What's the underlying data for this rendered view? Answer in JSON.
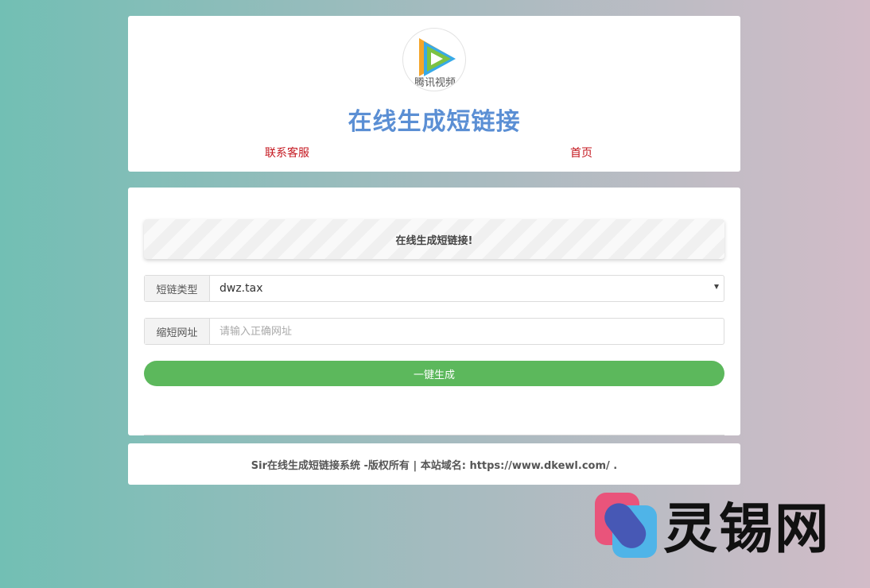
{
  "header": {
    "logo_text": "腾讯视频",
    "title": "在线生成短链接",
    "nav": [
      {
        "label": "联系客服"
      },
      {
        "label": "首页"
      }
    ]
  },
  "form": {
    "notice": "在线生成短链接!",
    "type_label": "短链类型",
    "type_value": "dwz.tax",
    "url_label": "缩短网址",
    "url_placeholder": "请输入正确网址",
    "url_value": "",
    "submit_label": "一键生成"
  },
  "footer": {
    "text": "Sir在线生成短链接系统 -版权所有 | 本站域名: https://www.dkewl.com/ ."
  },
  "watermark": {
    "text": "灵锡网"
  },
  "colors": {
    "title": "#5b8fd4",
    "nav_link": "#c4171f",
    "button": "#5cb85c"
  }
}
